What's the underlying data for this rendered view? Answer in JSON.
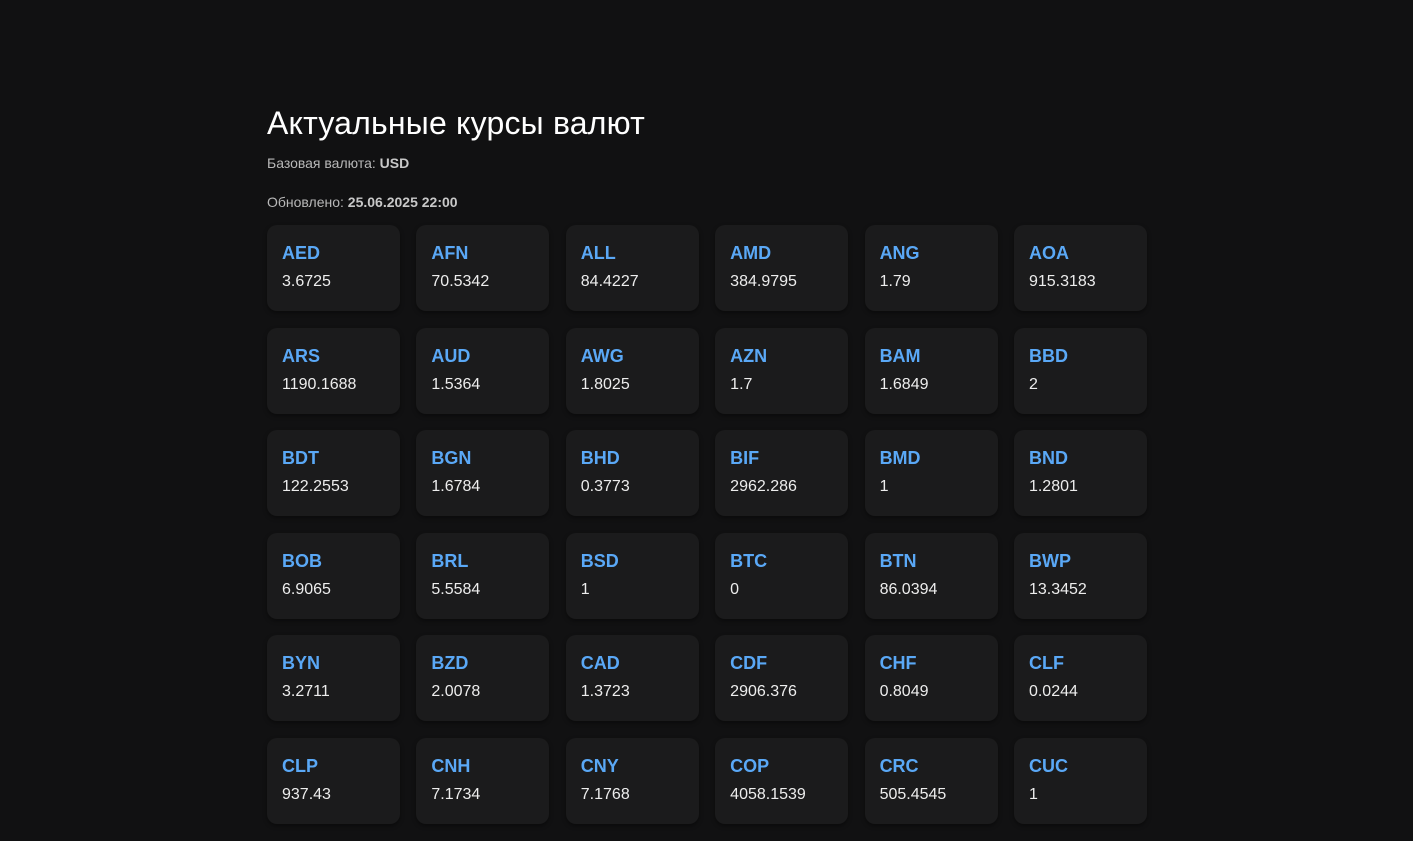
{
  "header": {
    "title": "Актуальные курсы валют",
    "base_label": "Базовая валюта:",
    "base_value": "USD",
    "updated_label": "Обновлено:",
    "updated_value": "25.06.2025 22:00"
  },
  "colors": {
    "background": "#111112",
    "card": "#1b1b1c",
    "accent": "#5aa8f6"
  },
  "rates": [
    {
      "code": "AED",
      "value": "3.6725"
    },
    {
      "code": "AFN",
      "value": "70.5342"
    },
    {
      "code": "ALL",
      "value": "84.4227"
    },
    {
      "code": "AMD",
      "value": "384.9795"
    },
    {
      "code": "ANG",
      "value": "1.79"
    },
    {
      "code": "AOA",
      "value": "915.3183"
    },
    {
      "code": "ARS",
      "value": "1190.1688"
    },
    {
      "code": "AUD",
      "value": "1.5364"
    },
    {
      "code": "AWG",
      "value": "1.8025"
    },
    {
      "code": "AZN",
      "value": "1.7"
    },
    {
      "code": "BAM",
      "value": "1.6849"
    },
    {
      "code": "BBD",
      "value": "2"
    },
    {
      "code": "BDT",
      "value": "122.2553"
    },
    {
      "code": "BGN",
      "value": "1.6784"
    },
    {
      "code": "BHD",
      "value": "0.3773"
    },
    {
      "code": "BIF",
      "value": "2962.286"
    },
    {
      "code": "BMD",
      "value": "1"
    },
    {
      "code": "BND",
      "value": "1.2801"
    },
    {
      "code": "BOB",
      "value": "6.9065"
    },
    {
      "code": "BRL",
      "value": "5.5584"
    },
    {
      "code": "BSD",
      "value": "1"
    },
    {
      "code": "BTC",
      "value": "0"
    },
    {
      "code": "BTN",
      "value": "86.0394"
    },
    {
      "code": "BWP",
      "value": "13.3452"
    },
    {
      "code": "BYN",
      "value": "3.2711"
    },
    {
      "code": "BZD",
      "value": "2.0078"
    },
    {
      "code": "CAD",
      "value": "1.3723"
    },
    {
      "code": "CDF",
      "value": "2906.376"
    },
    {
      "code": "CHF",
      "value": "0.8049"
    },
    {
      "code": "CLF",
      "value": "0.0244"
    },
    {
      "code": "CLP",
      "value": "937.43"
    },
    {
      "code": "CNH",
      "value": "7.1734"
    },
    {
      "code": "CNY",
      "value": "7.1768"
    },
    {
      "code": "COP",
      "value": "4058.1539"
    },
    {
      "code": "CRC",
      "value": "505.4545"
    },
    {
      "code": "CUC",
      "value": "1"
    }
  ]
}
